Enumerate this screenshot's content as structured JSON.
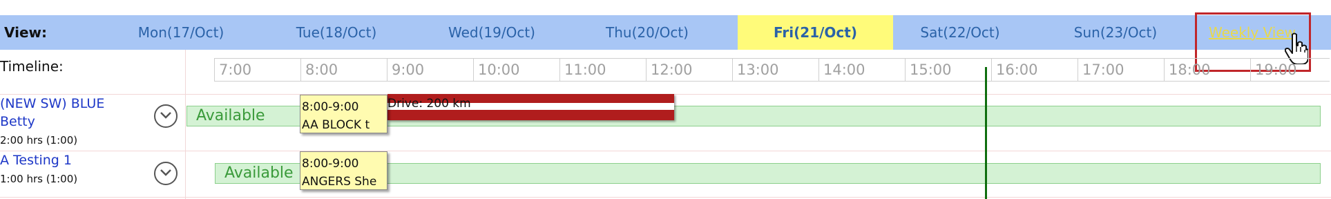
{
  "header": {
    "view_label": "View:",
    "days": [
      {
        "label": "Mon(17/Oct)",
        "active": false
      },
      {
        "label": "Tue(18/Oct)",
        "active": false
      },
      {
        "label": "Wed(19/Oct)",
        "active": false
      },
      {
        "label": "Thu(20/Oct)",
        "active": false
      },
      {
        "label": "Fri(21/Oct)",
        "active": true
      },
      {
        "label": "Sat(22/Oct)",
        "active": false
      },
      {
        "label": "Sun(23/Oct)",
        "active": false
      }
    ],
    "weekly_view": "Weekly View"
  },
  "timeline": {
    "label": "Timeline:",
    "hours": [
      "7:00",
      "8:00",
      "9:00",
      "10:00",
      "11:00",
      "12:00",
      "13:00",
      "14:00",
      "15:00",
      "16:00",
      "17:00",
      "18:00",
      "19:00"
    ]
  },
  "resources": [
    {
      "name_line1": "(NEW SW) BLUE",
      "name_line2": "Betty",
      "hours": "2:00 hrs (1:00)",
      "availability": "Available",
      "appointment": {
        "time": "8:00-9:00",
        "title": "AA BLOCK t"
      },
      "drive": "Drive: 200 km"
    },
    {
      "name_line1": "A Testing 1",
      "hours": "1:00 hrs (1:00)",
      "availability": "Available",
      "appointment": {
        "time": "8:00-9:00",
        "title": "ANGERS She"
      }
    }
  ],
  "colors": {
    "header_bg": "#a8c6f5",
    "active_day_bg": "#fffb7a",
    "available_green": "#d4f2d4",
    "drive_red": "#b01d1d",
    "highlight_red": "#c0262a"
  }
}
